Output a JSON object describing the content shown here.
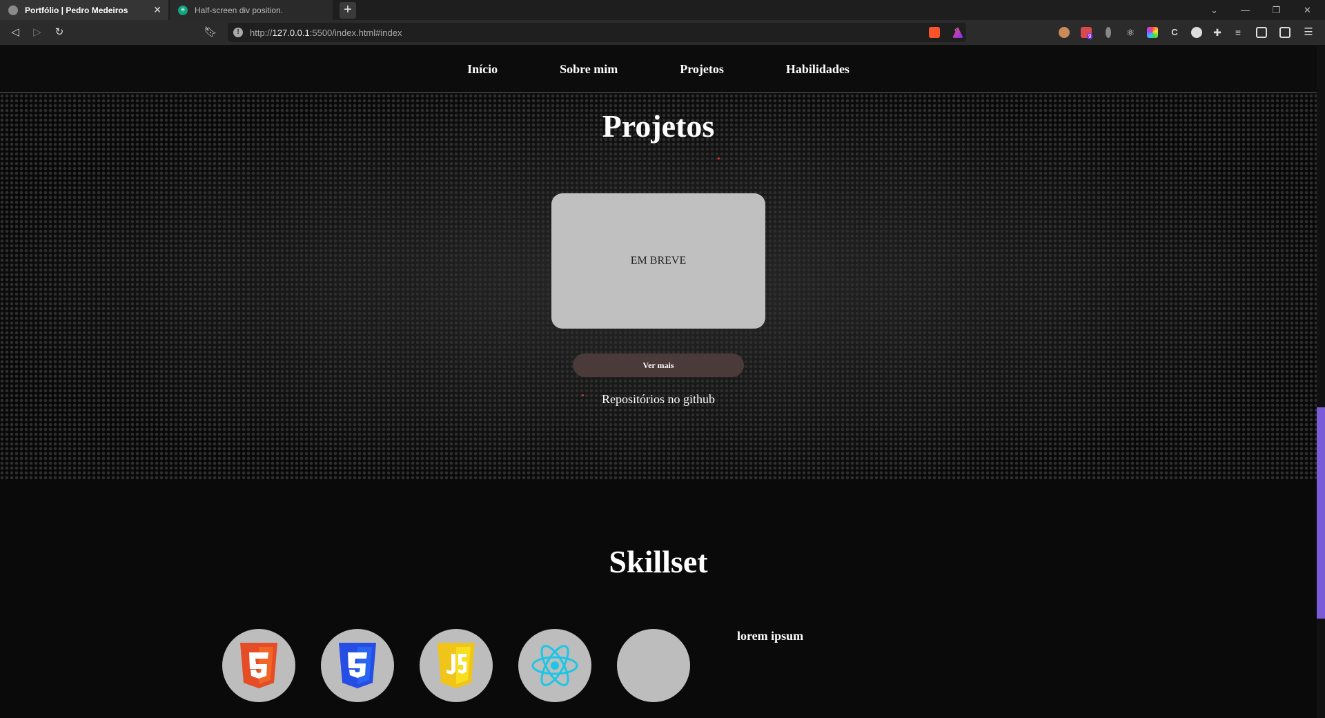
{
  "browser": {
    "tabs": [
      {
        "label": "Portfólio | Pedro Medeiros",
        "active": true
      },
      {
        "label": "Half-screen div position.",
        "active": false
      }
    ],
    "url_prefix": "http://",
    "url_host": "127.0.0.1",
    "url_rest": ":5500/index.html#index",
    "ext_badge": "9"
  },
  "nav": {
    "items": [
      "Início",
      "Sobre mim",
      "Projetos",
      "Habilidades"
    ]
  },
  "projects": {
    "title": "Projetos",
    "card_text": "EM BREVE",
    "button_label": "Ver mais",
    "repo_link": "Repositórios no github"
  },
  "skills": {
    "title": "Skillset",
    "icons": [
      "html5-icon",
      "css3-icon",
      "javascript-icon",
      "react-icon",
      "empty-skill-icon"
    ],
    "side_text": "lorem ipsum"
  },
  "colors": {
    "accent_scroll": "#7b5cd8",
    "card_bg": "#c0c0c0",
    "button_bg": "#4a3a3a"
  }
}
